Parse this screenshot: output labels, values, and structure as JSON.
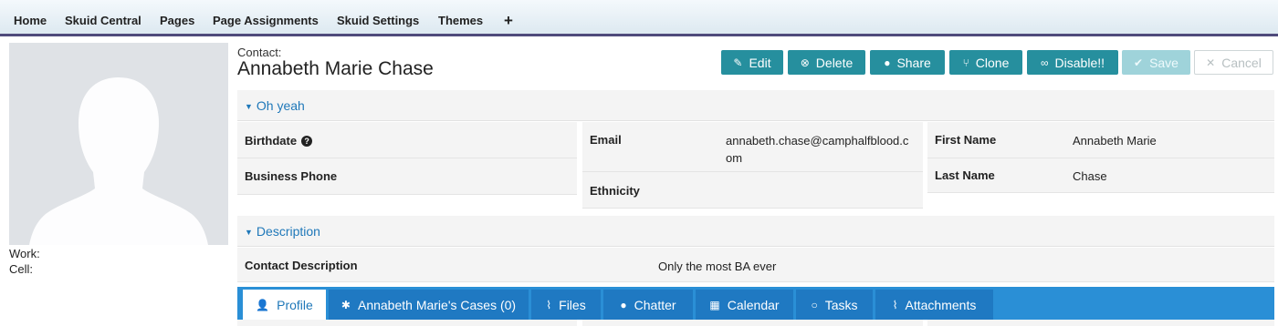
{
  "nav": {
    "items": [
      "Home",
      "Skuid Central",
      "Pages",
      "Page Assignments",
      "Skuid Settings",
      "Themes"
    ],
    "add_label": "+"
  },
  "sidebar": {
    "work_label": "Work:",
    "cell_label": "Cell:"
  },
  "header": {
    "object_type": "Contact:",
    "record_name": "Annabeth Marie Chase"
  },
  "buttons": {
    "edit": "Edit",
    "delete": "Delete",
    "share": "Share",
    "clone": "Clone",
    "disable": "Disable!!",
    "save": "Save",
    "cancel": "Cancel"
  },
  "sections": {
    "oh_yeah": {
      "title": "Oh yeah",
      "birthdate_label": "Birthdate",
      "business_phone_label": "Business Phone",
      "email_label": "Email",
      "email_value": "annabeth.chase@camphalfblood.com",
      "ethnicity_label": "Ethnicity",
      "first_name_label": "First Name",
      "first_name_value": "Annabeth Marie",
      "last_name_label": "Last Name",
      "last_name_value": "Chase"
    },
    "description": {
      "title": "Description",
      "contact_description_label": "Contact Description",
      "contact_description_value": "Only the most BA ever"
    }
  },
  "tabs": [
    "Profile",
    "Annabeth Marie's Cases (0)",
    "Files",
    "Chatter",
    "Calendar",
    "Tasks",
    "Attachments"
  ],
  "active_tab": "Profile",
  "colors": {
    "nav_border": "#4f4a7c",
    "button_teal": "#268f9e",
    "tab_blue": "#1f79c2",
    "link_blue": "#1f78b9"
  }
}
